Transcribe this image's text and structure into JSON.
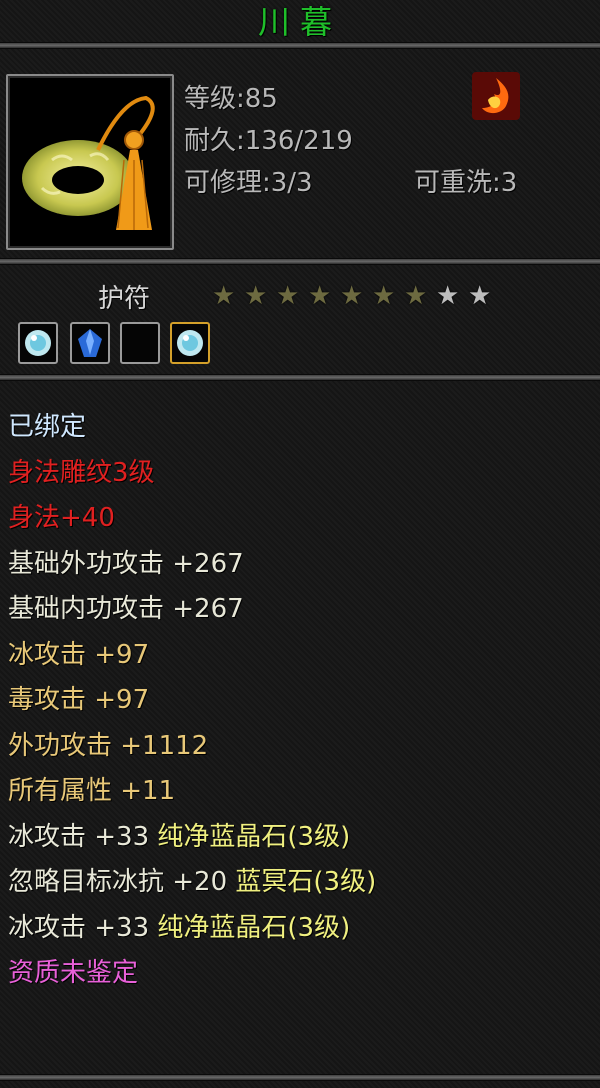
{
  "item": {
    "name": "川暮",
    "type": "护符",
    "icon": "jade-ring-icon"
  },
  "stats": {
    "level": "等级:85",
    "durability": "耐久:136/219",
    "repair": "可修理:3/3",
    "rewash": "可重洗:3"
  },
  "stars": {
    "lit": 7,
    "total": 9
  },
  "sockets": [
    {
      "state": "gem",
      "icon": "white-crystal-icon"
    },
    {
      "state": "gem",
      "icon": "blue-crystal-icon"
    },
    {
      "state": "empty",
      "icon": ""
    },
    {
      "state": "gem",
      "icon": "white-crystal-icon"
    }
  ],
  "attributes": [
    {
      "text": "已绑定",
      "color": "#d0e8ff"
    },
    {
      "text": "身法雕纹3级",
      "color": "#e02020"
    },
    {
      "text": "身法+40",
      "color": "#e02020"
    },
    {
      "text": "基础外功攻击  +267",
      "color": "#e8e8d8"
    },
    {
      "text": "基础内功攻击  +267",
      "color": "#e8e8d8"
    },
    {
      "text": "冰攻击  +97",
      "color": "#e8c878"
    },
    {
      "text": "毒攻击  +97",
      "color": "#e8c878"
    },
    {
      "text": "外功攻击  +1112",
      "color": "#e8c878"
    },
    {
      "text": "所有属性  +11",
      "color": "#e8c878"
    },
    {
      "prefix": "冰攻击  +33  ",
      "suffix": "纯净蓝晶石(3级)",
      "color": "#e8e8d8",
      "suffix_color": "#f0f080"
    },
    {
      "prefix": "忽略目标冰抗  +20  ",
      "suffix": "蓝冥石(3级)",
      "color": "#e8e8d8",
      "suffix_color": "#f0f080"
    },
    {
      "prefix": "冰攻击  +33  ",
      "suffix": "纯净蓝晶石(3级)",
      "color": "#e8e8d8",
      "suffix_color": "#f0f080"
    },
    {
      "text": "资质未鉴定",
      "color": "#e860d8"
    }
  ],
  "colors": {
    "title": "#1fbf2a",
    "star_lit": "#6d6a40",
    "star_dim": "#bdbdbd"
  }
}
